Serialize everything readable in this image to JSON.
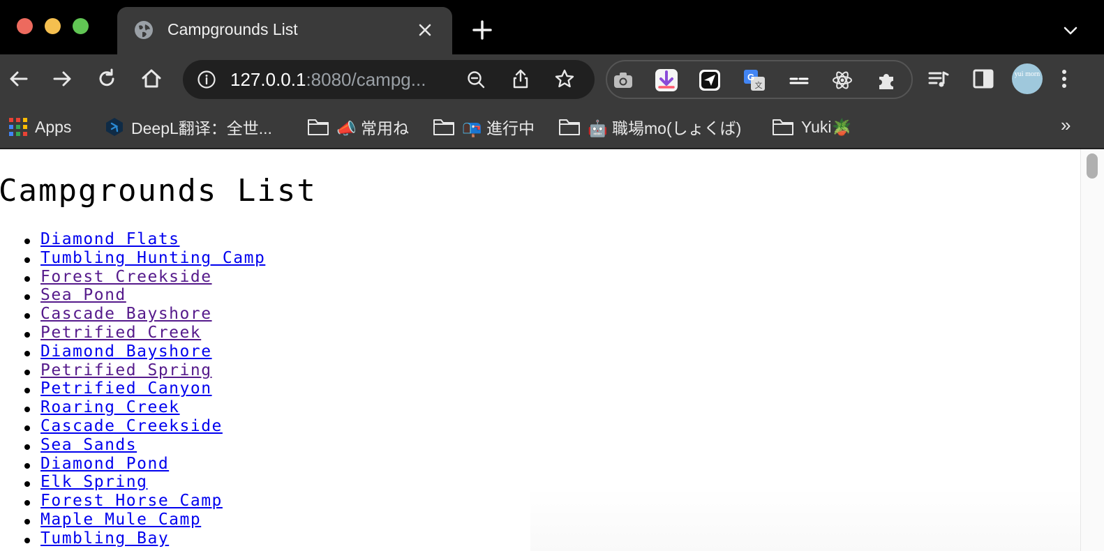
{
  "window": {
    "controls": [
      "close",
      "minimize",
      "zoom"
    ]
  },
  "tab": {
    "title": "Campgrounds List",
    "close_icon": "close-icon",
    "globe_icon": "globe-icon"
  },
  "toolbar": {
    "url_host": "127.0.0.1",
    "url_path": ":8080/campg..."
  },
  "bookmarks": [
    {
      "label": "Apps",
      "icon": "apps-grid-icon"
    },
    {
      "label": "DeepL翻译：全世...",
      "icon": "deepl-icon"
    },
    {
      "label": "📣 常用ね",
      "icon": "folder-icon"
    },
    {
      "label": "📭 進行中",
      "icon": "folder-icon"
    },
    {
      "label": "🤖 職場mo(しょくば)",
      "icon": "folder-icon"
    },
    {
      "label": "Yuki🪴",
      "icon": "folder-icon"
    }
  ],
  "bookmarks_overflow": "»",
  "avatar_text": "yui morn",
  "page": {
    "title": "Campgrounds List",
    "campgrounds": [
      {
        "name": "Diamond Flats",
        "visited": false
      },
      {
        "name": "Tumbling Hunting Camp",
        "visited": false
      },
      {
        "name": "Forest Creekside",
        "visited": true
      },
      {
        "name": "Sea Pond",
        "visited": true
      },
      {
        "name": "Cascade Bayshore",
        "visited": true
      },
      {
        "name": "Petrified Creek",
        "visited": true
      },
      {
        "name": "Diamond Bayshore",
        "visited": false
      },
      {
        "name": "Petrified Spring",
        "visited": true
      },
      {
        "name": "Petrified Canyon",
        "visited": false
      },
      {
        "name": "Roaring Creek",
        "visited": false
      },
      {
        "name": "Cascade Creekside",
        "visited": false
      },
      {
        "name": "Sea Sands",
        "visited": false
      },
      {
        "name": "Diamond Pond",
        "visited": false
      },
      {
        "name": "Elk Spring",
        "visited": false
      },
      {
        "name": "Forest Horse Camp",
        "visited": false
      },
      {
        "name": "Maple Mule Camp",
        "visited": false
      },
      {
        "name": "Tumbling Bay",
        "visited": false
      }
    ]
  },
  "colors": {
    "link": "#0000ee",
    "visited_link": "#551a8b",
    "chrome_dark": "#3a3a3a"
  }
}
